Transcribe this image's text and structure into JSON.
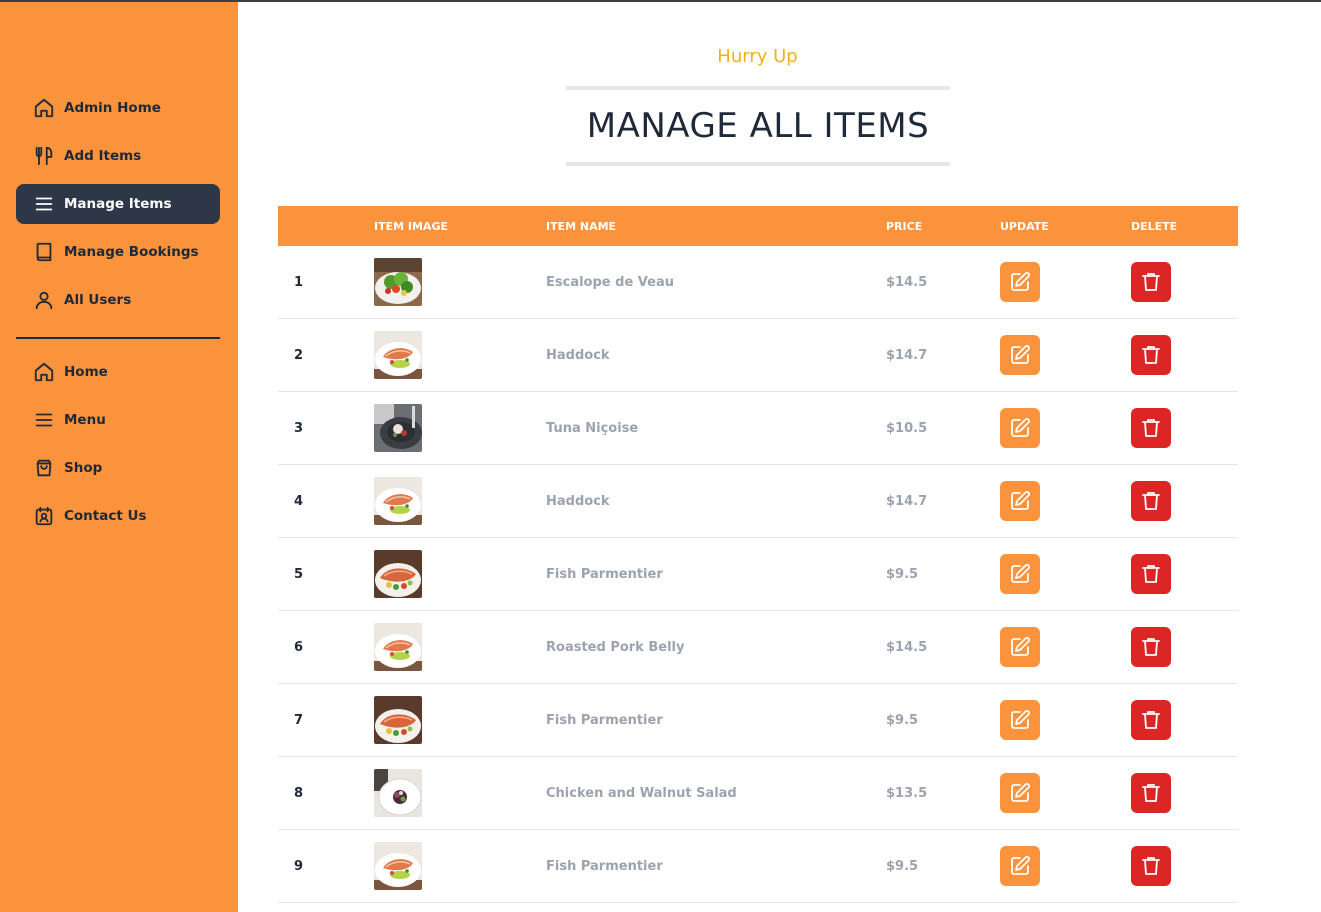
{
  "sidebar": {
    "admin_items": [
      {
        "label": "Admin Home",
        "icon": "home-icon"
      },
      {
        "label": "Add Items",
        "icon": "utensils-icon"
      },
      {
        "label": "Manage Items",
        "icon": "menu-icon",
        "active": true
      },
      {
        "label": "Manage Bookings",
        "icon": "book-icon"
      },
      {
        "label": "All Users",
        "icon": "user-icon"
      }
    ],
    "site_items": [
      {
        "label": "Home",
        "icon": "home-icon"
      },
      {
        "label": "Menu",
        "icon": "menu-icon"
      },
      {
        "label": "Shop",
        "icon": "shopping-bag-icon"
      },
      {
        "label": "Contact Us",
        "icon": "contact-icon"
      }
    ]
  },
  "header": {
    "subheading": "Hurry Up",
    "title": "MANAGE ALL ITEMS"
  },
  "table": {
    "columns": [
      "",
      "ITEM IMAGE",
      "ITEM NAME",
      "PRICE",
      "UPDATE",
      "DELETE"
    ],
    "rows": [
      {
        "index": "1",
        "name": "Escalope de Veau",
        "price": "$14.5",
        "image": "salad"
      },
      {
        "index": "2",
        "name": "Haddock",
        "price": "$14.7",
        "image": "salmon-plate"
      },
      {
        "index": "3",
        "name": "Tuna Niçoise",
        "price": "$10.5",
        "image": "dark-plate"
      },
      {
        "index": "4",
        "name": "Haddock",
        "price": "$14.7",
        "image": "salmon-plate"
      },
      {
        "index": "5",
        "name": "Fish Parmentier",
        "price": "$9.5",
        "image": "fish-dark"
      },
      {
        "index": "6",
        "name": "Roasted Pork Belly",
        "price": "$14.5",
        "image": "salmon-plate"
      },
      {
        "index": "7",
        "name": "Fish Parmentier",
        "price": "$9.5",
        "image": "fish-dark"
      },
      {
        "index": "8",
        "name": "Chicken and Walnut Salad",
        "price": "$13.5",
        "image": "white-plate"
      },
      {
        "index": "9",
        "name": "Fish Parmentier",
        "price": "$9.5",
        "image": "salmon-plate"
      }
    ]
  },
  "colors": {
    "sidebar": "#fb923c",
    "active_nav": "#2d3748",
    "header_row": "#fb923c",
    "update_button": "#fb923c",
    "delete_button": "#dc2626",
    "subheading": "#f0b21a"
  }
}
